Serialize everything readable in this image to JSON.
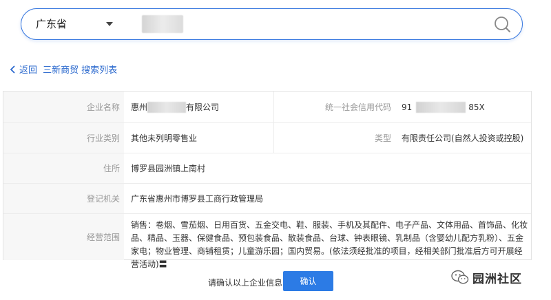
{
  "search": {
    "province": "广东省"
  },
  "breadcrumb": {
    "back_label": "返回",
    "company_short": "三新商贸",
    "list_label": "搜索列表"
  },
  "company": {
    "name_label": "企业名称",
    "name_prefix": "惠州",
    "name_suffix": "有限公司",
    "credit_code_label": "统一社会信用代码",
    "credit_code_prefix": "91",
    "credit_code_suffix": "85X",
    "industry_label": "行业类别",
    "industry_value": "其他未列明零售业",
    "type_label": "类型",
    "type_value": "有限责任公司(自然人投资或控股)",
    "address_label": "住所",
    "address_value": "博罗县园洲镇上南村",
    "authority_label": "登记机关",
    "authority_value": "广东省惠州市博罗县工商行政管理局",
    "scope_label": "经营范围",
    "scope_value": "销售：卷烟、雪茄烟、日用百货、五金交电、鞋、服装、手机及其配件、电子产品、文体用品、首饰品、化妆品、精品、玉器、保健食品、预包装食品、散装食品、台球、钟表眼镜、乳制品（含婴幼儿配方乳粉）、五金家电；物业管理、商铺租赁；儿童游乐园；国内贸易。(依法须经批准的项目，经相关部门批准后方可开展经营活动)〓"
  },
  "confirm": {
    "prompt": "请确认以上企业信息",
    "button_label": "确认"
  },
  "watermark": {
    "text": "园洲社区"
  },
  "colors": {
    "accent": "#2c7be5",
    "link": "#2f6ccf",
    "label_bg": "#f7f7f7"
  }
}
